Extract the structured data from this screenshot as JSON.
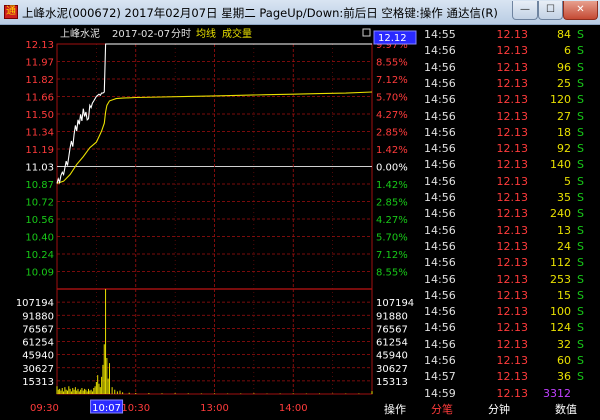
{
  "window": {
    "title": "上峰水泥(000672) 2017年02月07日 星期二 PageUp/Down:前后日 空格键:操作 通达信(R)",
    "min_label": "—",
    "max_label": "☐",
    "close_label": "✕"
  },
  "chart_header": {
    "stock": "上峰水泥",
    "date": "2017-02-07",
    "mode": "分时",
    "avg_label": "均线",
    "vol_label": "成交量",
    "cursor_price": "12.12"
  },
  "colors": {
    "up": "#ff3b3b",
    "down": "#18c818",
    "neutral": "#ffffff",
    "price_line": "#ffffff",
    "avg_line": "#e8e000",
    "volume": "#e8e000",
    "grid": "#a01010",
    "cursor_box": "#2a2aff"
  },
  "chart_data": {
    "type": "line",
    "prev_close": 11.03,
    "price_axis": {
      "labels": [
        "12.13",
        "11.97",
        "11.82",
        "11.66",
        "11.50",
        "11.34",
        "11.19",
        "11.03",
        "10.87",
        "10.72",
        "10.56",
        "10.40",
        "10.24",
        "10.09"
      ],
      "values": [
        12.13,
        11.97,
        11.82,
        11.66,
        11.5,
        11.34,
        11.19,
        11.03,
        10.87,
        10.72,
        10.56,
        10.4,
        10.24,
        10.09
      ],
      "ylim": [
        10.09,
        12.13
      ]
    },
    "pct_axis": {
      "labels": [
        "9.97%",
        "8.55%",
        "7.12%",
        "5.70%",
        "4.27%",
        "2.85%",
        "1.42%",
        "0.00%",
        "1.42%",
        "2.85%",
        "4.27%",
        "5.70%",
        "7.12%",
        "8.55%"
      ]
    },
    "volume_axis": {
      "labels": [
        "107194",
        "91880",
        "76567",
        "61254",
        "45940",
        "30627",
        "15313"
      ],
      "values": [
        107194,
        91880,
        76567,
        61254,
        45940,
        30627,
        15313
      ],
      "ylim": [
        0,
        122508
      ]
    },
    "time_axis": {
      "labels": [
        "09:30",
        "10:30",
        "13:00",
        "14:00"
      ],
      "cursor_time": "10:07",
      "xlim_minutes": [
        0,
        240
      ],
      "label_minutes": [
        0,
        60,
        120,
        180
      ],
      "cursor_minute": 37
    },
    "series": [
      {
        "x": [
          0,
          1,
          2,
          3,
          4,
          5,
          6,
          7,
          8,
          9,
          10,
          11,
          12,
          13,
          14,
          15,
          16,
          17,
          18,
          19,
          20,
          21,
          22,
          23,
          24,
          25,
          26,
          27,
          28,
          29,
          30,
          31,
          32,
          33,
          34,
          35,
          36,
          37,
          38,
          39,
          40,
          45,
          50,
          60,
          80,
          100,
          120,
          140,
          160,
          180,
          200,
          220,
          240
        ],
        "y": [
          10.88,
          10.92,
          10.89,
          10.95,
          10.98,
          10.96,
          11.02,
          11.08,
          11.04,
          11.12,
          11.2,
          11.26,
          11.21,
          11.32,
          11.4,
          11.35,
          11.45,
          11.41,
          11.5,
          11.44,
          11.55,
          11.48,
          11.52,
          11.45,
          11.46,
          11.58,
          11.56,
          11.6,
          11.62,
          11.64,
          11.66,
          11.67,
          11.68,
          11.67,
          11.69,
          11.69,
          11.7,
          12.13,
          12.13,
          12.13,
          12.13,
          12.13,
          12.13,
          12.13,
          12.13,
          12.13,
          12.13,
          12.13,
          12.13,
          12.13,
          12.13,
          12.13,
          12.13
        ]
      },
      {
        "x": [
          0,
          5,
          10,
          15,
          20,
          25,
          30,
          32,
          34,
          36,
          37,
          38,
          40,
          45,
          50,
          60,
          80,
          100,
          120,
          140,
          160,
          180,
          200,
          220,
          240
        ],
        "y": [
          10.88,
          10.9,
          10.96,
          11.05,
          11.12,
          11.2,
          11.25,
          11.3,
          11.35,
          11.42,
          11.52,
          11.58,
          11.62,
          11.64,
          11.645,
          11.65,
          11.655,
          11.66,
          11.665,
          11.67,
          11.675,
          11.68,
          11.685,
          11.69,
          11.7
        ]
      },
      {
        "x": [
          0,
          1,
          2,
          3,
          4,
          5,
          6,
          7,
          8,
          9,
          10,
          11,
          12,
          13,
          14,
          15,
          16,
          17,
          18,
          19,
          20,
          21,
          22,
          23,
          24,
          25,
          26,
          27,
          28,
          29,
          30,
          31,
          32,
          33,
          34,
          35,
          36,
          37,
          38,
          39,
          40,
          42,
          44,
          46,
          48,
          50,
          55,
          60,
          70,
          80,
          90,
          100,
          110,
          120,
          130,
          140,
          150,
          160,
          170,
          180,
          190,
          200,
          210,
          220,
          230,
          240
        ],
        "y": [
          9000,
          5000,
          6000,
          4000,
          7000,
          3000,
          8000,
          5000,
          4000,
          9000,
          6000,
          3000,
          7000,
          5000,
          8000,
          4000,
          6000,
          3000,
          5000,
          7000,
          4000,
          6000,
          5000,
          3000,
          6000,
          4000,
          5000,
          3000,
          7000,
          9000,
          14000,
          22000,
          12000,
          8000,
          20000,
          34000,
          58000,
          122508,
          42000,
          18000,
          36000,
          8000,
          5000,
          3000,
          4000,
          2000,
          1500,
          1200,
          1000,
          800,
          900,
          700,
          600,
          700,
          500,
          600,
          800,
          500,
          600,
          700,
          500,
          600,
          400,
          500,
          600,
          3312
        ]
      }
    ]
  },
  "tape": {
    "rows": [
      {
        "time": "14:55",
        "price": "12.13",
        "vol": "84",
        "dir": "S"
      },
      {
        "time": "14:56",
        "price": "12.13",
        "vol": "6",
        "dir": "S"
      },
      {
        "time": "14:56",
        "price": "12.13",
        "vol": "96",
        "dir": "S"
      },
      {
        "time": "14:56",
        "price": "12.13",
        "vol": "25",
        "dir": "S"
      },
      {
        "time": "14:56",
        "price": "12.13",
        "vol": "120",
        "dir": "S"
      },
      {
        "time": "14:56",
        "price": "12.13",
        "vol": "27",
        "dir": "S"
      },
      {
        "time": "14:56",
        "price": "12.13",
        "vol": "18",
        "dir": "S"
      },
      {
        "time": "14:56",
        "price": "12.13",
        "vol": "92",
        "dir": "S"
      },
      {
        "time": "14:56",
        "price": "12.13",
        "vol": "140",
        "dir": "S"
      },
      {
        "time": "14:56",
        "price": "12.13",
        "vol": "5",
        "dir": "S"
      },
      {
        "time": "14:56",
        "price": "12.13",
        "vol": "35",
        "dir": "S"
      },
      {
        "time": "14:56",
        "price": "12.13",
        "vol": "240",
        "dir": "S"
      },
      {
        "time": "14:56",
        "price": "12.13",
        "vol": "13",
        "dir": "S"
      },
      {
        "time": "14:56",
        "price": "12.13",
        "vol": "24",
        "dir": "S"
      },
      {
        "time": "14:56",
        "price": "12.13",
        "vol": "112",
        "dir": "S"
      },
      {
        "time": "14:56",
        "price": "12.13",
        "vol": "253",
        "dir": "S"
      },
      {
        "time": "14:56",
        "price": "12.13",
        "vol": "15",
        "dir": "S"
      },
      {
        "time": "14:56",
        "price": "12.13",
        "vol": "100",
        "dir": "S"
      },
      {
        "time": "14:56",
        "price": "12.13",
        "vol": "124",
        "dir": "S"
      },
      {
        "time": "14:56",
        "price": "12.13",
        "vol": "32",
        "dir": "S"
      },
      {
        "time": "14:56",
        "price": "12.13",
        "vol": "60",
        "dir": "S"
      },
      {
        "time": "14:57",
        "price": "12.13",
        "vol": "36",
        "dir": "S"
      },
      {
        "time": "14:59",
        "price": "12.13",
        "vol": "3312",
        "dir": ""
      }
    ]
  },
  "bottom_bar": {
    "ops": "操作",
    "tick": "分笔",
    "minute": "分钟",
    "value": "数值"
  }
}
